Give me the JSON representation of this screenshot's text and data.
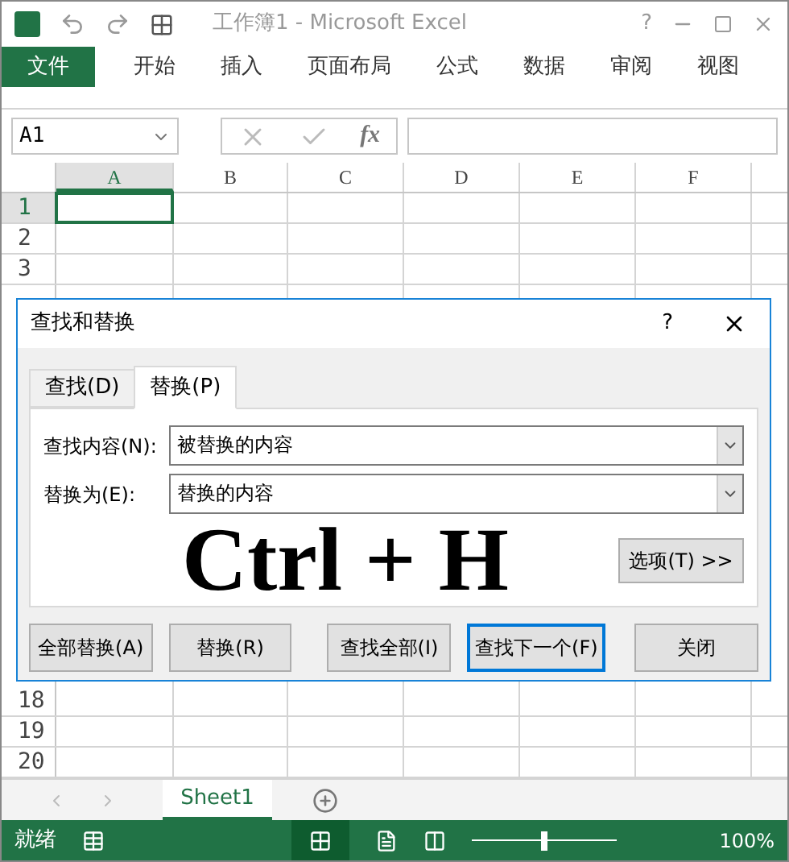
{
  "window": {
    "title": "工作簿1 - Microsoft Excel",
    "help": "?"
  },
  "ribbon_tabs": [
    {
      "label": "文件",
      "kind": "file"
    },
    {
      "label": "开始",
      "kind": "tab"
    },
    {
      "label": "插入",
      "kind": "tab"
    },
    {
      "label": "页面布局",
      "kind": "tab"
    },
    {
      "label": "公式",
      "kind": "tab"
    },
    {
      "label": "数据",
      "kind": "tab"
    },
    {
      "label": "审阅",
      "kind": "tab"
    },
    {
      "label": "视图",
      "kind": "tab"
    }
  ],
  "formula_bar": {
    "name_box": "A1",
    "fx": "fx"
  },
  "columns": [
    {
      "label": "A",
      "selected": true
    },
    {
      "label": "B",
      "selected": false
    },
    {
      "label": "C",
      "selected": false
    },
    {
      "label": "D",
      "selected": false
    },
    {
      "label": "E",
      "selected": false
    },
    {
      "label": "F",
      "selected": false
    }
  ],
  "rows_top": [
    {
      "label": "1",
      "selected": true
    },
    {
      "label": "2",
      "selected": false
    },
    {
      "label": "3",
      "selected": false
    }
  ],
  "rows_bottom": [
    {
      "label": "18",
      "selected": false
    },
    {
      "label": "19",
      "selected": false
    },
    {
      "label": "20",
      "selected": false
    }
  ],
  "dialog": {
    "title": "查找和替换",
    "help": "?",
    "tabs": [
      {
        "label": "查找(D)",
        "selected": false
      },
      {
        "label": "替换(P)",
        "selected": true
      }
    ],
    "fields": [
      {
        "label": "查找内容(N):",
        "value": "被替换的内容"
      },
      {
        "label": "替换为(E):",
        "value": "替换的内容"
      }
    ],
    "overlay_text": "Ctrl + H",
    "options_button": "选项(T) >>",
    "buttons": [
      {
        "label": "全部替换(A)",
        "default": false
      },
      {
        "label": "替换(R)",
        "default": false
      },
      {
        "label": "查找全部(I)",
        "default": false
      },
      {
        "label": "查找下一个(F)",
        "default": true
      },
      {
        "label": "关闭",
        "default": false
      }
    ]
  },
  "sheet_tabs": [
    {
      "label": "Sheet1",
      "selected": true
    }
  ],
  "status_bar": {
    "text": "就绪",
    "zoom_slider": {
      "level": 0.5
    },
    "zoom": "100%"
  }
}
